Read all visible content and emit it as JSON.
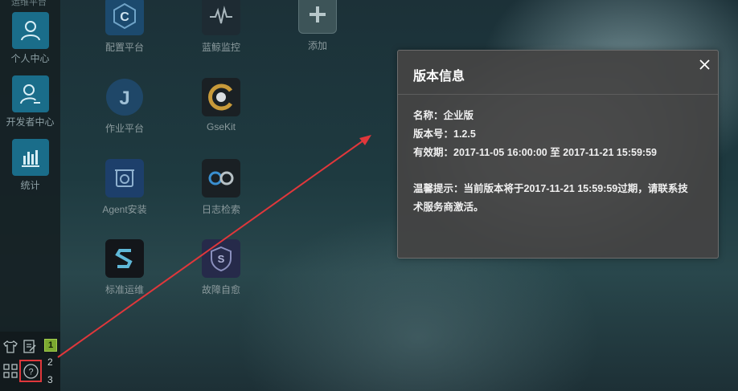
{
  "sidebar": {
    "top_partial_label": "运维平台",
    "items": [
      {
        "label": "个人中心",
        "icon": "user-icon"
      },
      {
        "label": "开发者中心",
        "icon": "developer-icon"
      },
      {
        "label": "统计",
        "icon": "bar-chart-icon"
      }
    ]
  },
  "apps": [
    {
      "label": "配置平台",
      "icon": "c-logo-icon",
      "color": "#1c4a6e"
    },
    {
      "label": "蓝鲸监控",
      "icon": "pulse-icon",
      "color": "#1e2b33"
    },
    {
      "label": "添加",
      "icon": "plus-icon",
      "color": "#3d5458"
    },
    {
      "label": "作业平台",
      "icon": "j-logo-icon",
      "color": "#1f4768"
    },
    {
      "label": "GseKit",
      "icon": "gsekit-icon",
      "color": "#1a2024"
    },
    {
      "label": "Agent安装",
      "icon": "agent-icon",
      "color": "#1d3f6b"
    },
    {
      "label": "日志检索",
      "icon": "infinity-icon",
      "color": "#1a2024"
    },
    {
      "label": "标准运维",
      "icon": "s-logo-icon",
      "color": "#13161a"
    },
    {
      "label": "故障自愈",
      "icon": "shield-icon",
      "color": "#262a4a"
    }
  ],
  "bottombar": {
    "badge_1": "1",
    "num_2": "2",
    "num_3": "3"
  },
  "dialog": {
    "title": "版本信息",
    "name_line": "名称：企业版",
    "version_line": "版本号：1.2.5",
    "validity_line": "有效期：2017-11-05 16:00:00 至 2017-11-21 15:59:59",
    "tip_line_1": "温馨提示：当前版本将于2017-11-21 15:59:59过期，请联系技",
    "tip_line_2": "术服务商激活。"
  },
  "annotation": {
    "color": "#e0373b"
  }
}
